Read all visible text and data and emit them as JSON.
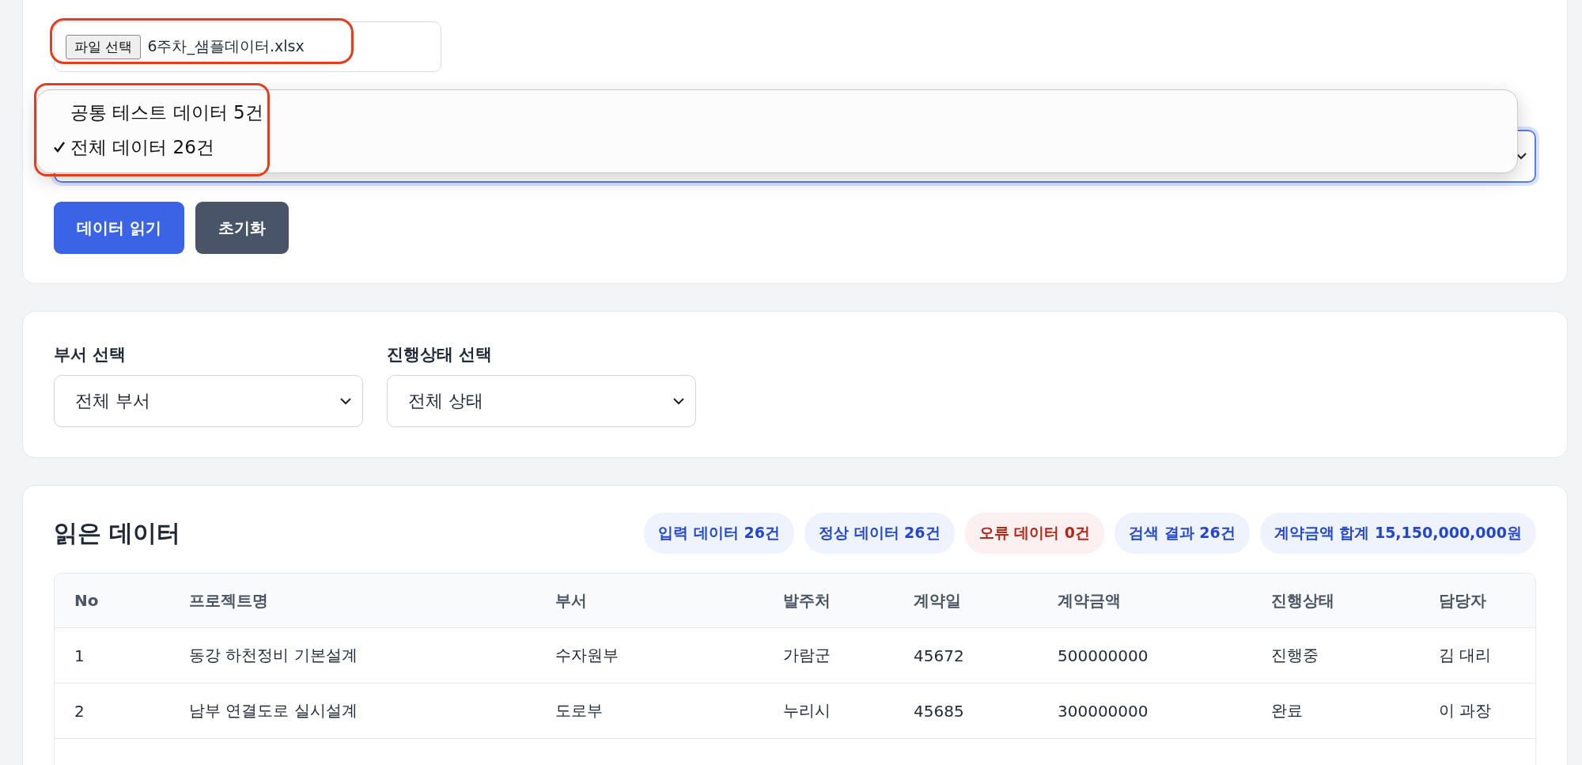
{
  "upload": {
    "button": "파일 선택",
    "file_name": "6주차_샘플데이터.xlsx"
  },
  "data_select": {
    "options": [
      {
        "label": "공통 테스트 데이터 5건",
        "selected": false
      },
      {
        "label": "전체 데이터 26건",
        "selected": true
      }
    ]
  },
  "actions": [
    "데이터 읽기",
    "초기화"
  ],
  "filters": [
    {
      "label": "부서 선택",
      "value": "전체 부서"
    },
    {
      "label": "진행상태 선택",
      "value": "전체 상태"
    }
  ],
  "results": {
    "title": "읽은 데이터",
    "badges": [
      {
        "text": "입력 데이터 26건",
        "kind": "info"
      },
      {
        "text": "정상 데이터 26건",
        "kind": "info"
      },
      {
        "text": "오류 데이터 0건",
        "kind": "error"
      },
      {
        "text": "검색 결과 26건",
        "kind": "info"
      },
      {
        "text": "계약금액 합계 15,150,000,000원",
        "kind": "info"
      }
    ],
    "table": {
      "columns": [
        "No",
        "프로젝트명",
        "부서",
        "발주처",
        "계약일",
        "계약금액",
        "진행상태",
        "담당자"
      ],
      "rows": [
        [
          "1",
          "동강 하천정비 기본설계",
          "수자원부",
          "가람군",
          "45672",
          "500000000",
          "진행중",
          "김 대리"
        ],
        [
          "2",
          "남부 연결도로 실시설계",
          "도로부",
          "누리시",
          "45685",
          "300000000",
          "완료",
          "이 과장"
        ]
      ]
    }
  }
}
